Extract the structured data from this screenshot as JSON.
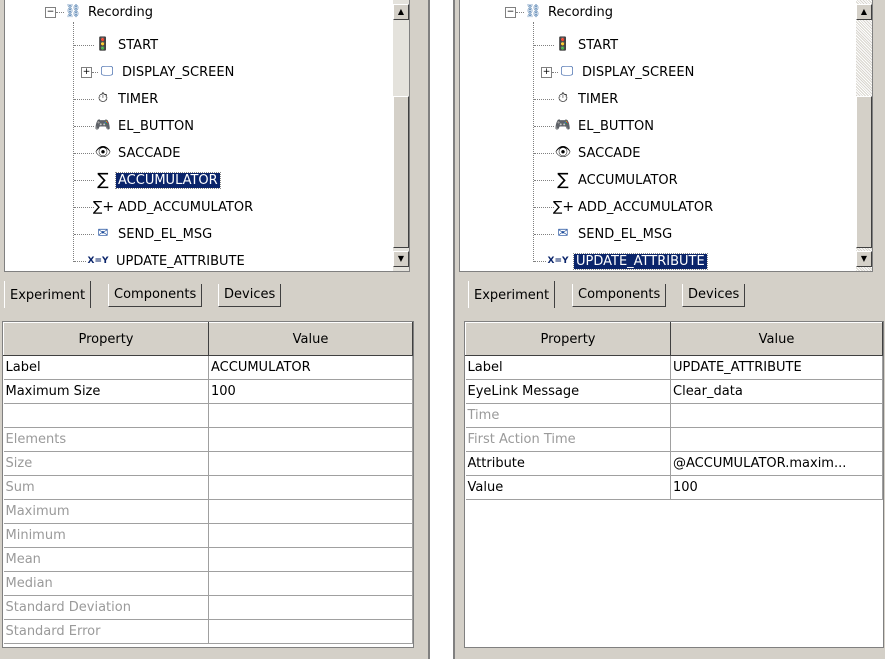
{
  "left": {
    "tree": {
      "root": "Recording",
      "items": [
        {
          "label": "START",
          "icon": "traffic-light-icon"
        },
        {
          "label": "DISPLAY_SCREEN",
          "icon": "monitor-icon",
          "expandable": true
        },
        {
          "label": "TIMER",
          "icon": "stopwatch-icon"
        },
        {
          "label": "EL_BUTTON",
          "icon": "gamepad-icon"
        },
        {
          "label": "SACCADE",
          "icon": "eye-icon"
        },
        {
          "label": "ACCUMULATOR",
          "icon": "sigma-icon",
          "selected": true
        },
        {
          "label": "ADD_ACCUMULATOR",
          "icon": "sigma-plus-icon"
        },
        {
          "label": "SEND_EL_MSG",
          "icon": "message-icon"
        },
        {
          "label": "UPDATE_ATTRIBUTE",
          "icon": "x-equals-y-icon",
          "icon_text": "X=Y"
        }
      ]
    },
    "tabs": [
      "Experiment",
      "Components",
      "Devices"
    ],
    "active_tab": "Experiment",
    "properties": {
      "headers": [
        "Property",
        "Value"
      ],
      "rows": [
        {
          "name": "Label",
          "value": "ACCUMULATOR",
          "enabled": true
        },
        {
          "name": "Maximum Size",
          "value": "100",
          "enabled": true
        },
        {
          "name": "",
          "value": "",
          "enabled": false
        },
        {
          "name": "Elements",
          "value": "",
          "enabled": false
        },
        {
          "name": "Size",
          "value": "",
          "enabled": false
        },
        {
          "name": "Sum",
          "value": "",
          "enabled": false
        },
        {
          "name": "Maximum",
          "value": "",
          "enabled": false
        },
        {
          "name": "Minimum",
          "value": "",
          "enabled": false
        },
        {
          "name": "Mean",
          "value": "",
          "enabled": false
        },
        {
          "name": "Median",
          "value": "",
          "enabled": false
        },
        {
          "name": "Standard Deviation",
          "value": "",
          "enabled": false
        },
        {
          "name": "Standard Error",
          "value": "",
          "enabled": false
        }
      ]
    }
  },
  "right": {
    "tree": {
      "root": "Recording",
      "items": [
        {
          "label": "START",
          "icon": "traffic-light-icon"
        },
        {
          "label": "DISPLAY_SCREEN",
          "icon": "monitor-icon",
          "expandable": true
        },
        {
          "label": "TIMER",
          "icon": "stopwatch-icon"
        },
        {
          "label": "EL_BUTTON",
          "icon": "gamepad-icon"
        },
        {
          "label": "SACCADE",
          "icon": "eye-icon"
        },
        {
          "label": "ACCUMULATOR",
          "icon": "sigma-icon"
        },
        {
          "label": "ADD_ACCUMULATOR",
          "icon": "sigma-plus-icon"
        },
        {
          "label": "SEND_EL_MSG",
          "icon": "message-icon"
        },
        {
          "label": "UPDATE_ATTRIBUTE",
          "icon": "x-equals-y-icon",
          "icon_text": "X=Y",
          "selected": true
        }
      ]
    },
    "tabs": [
      "Experiment",
      "Components",
      "Devices"
    ],
    "active_tab": "Experiment",
    "properties": {
      "headers": [
        "Property",
        "Value"
      ],
      "rows": [
        {
          "name": "Label",
          "value": "UPDATE_ATTRIBUTE",
          "enabled": true
        },
        {
          "name": "EyeLink Message",
          "value": "Clear_data",
          "enabled": true
        },
        {
          "name": "Time",
          "value": "",
          "enabled": false
        },
        {
          "name": "First Action Time",
          "value": "",
          "enabled": false
        },
        {
          "name": "Attribute",
          "value": "@ACCUMULATOR.maxim...",
          "enabled": true
        },
        {
          "name": "Value",
          "value": "100",
          "enabled": true
        }
      ]
    }
  },
  "colors": {
    "selection": "#0a246a",
    "panel": "#d4d0c8",
    "disabled_text": "#9a9a9a"
  }
}
